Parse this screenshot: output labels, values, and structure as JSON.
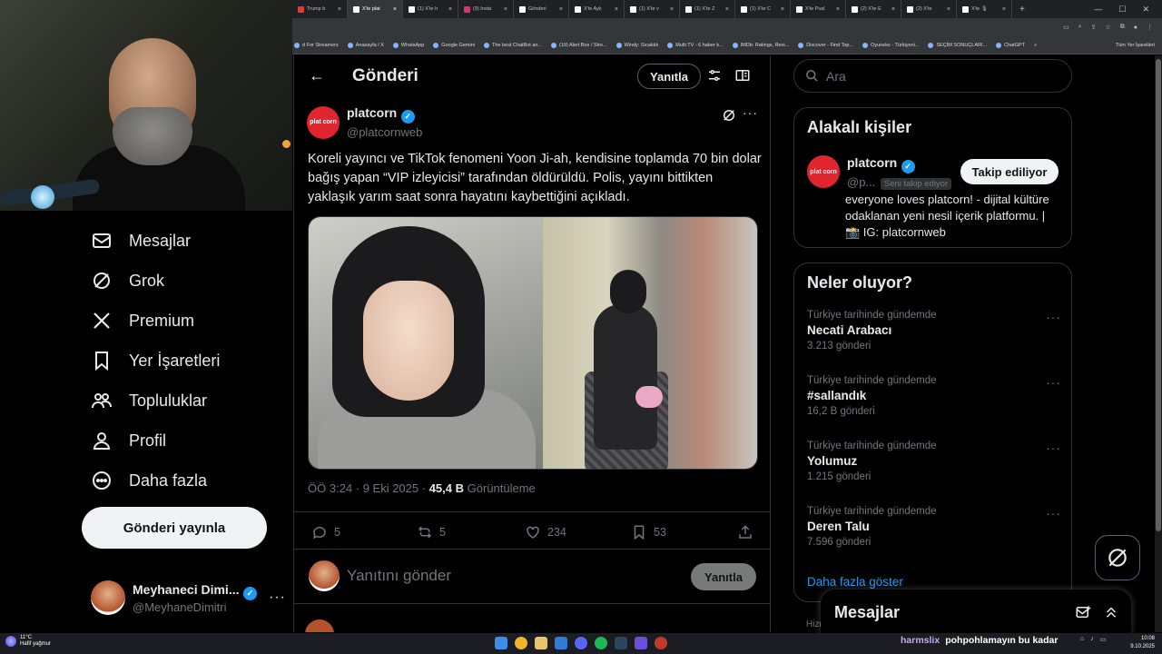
{
  "browser": {
    "tabs": [
      {
        "label": "Trump b",
        "color": "#e53935",
        "active": false
      },
      {
        "label": "X'te plat",
        "color": "#ffffff",
        "active": true
      },
      {
        "label": "(1) X'te h",
        "color": "#ffffff",
        "active": false
      },
      {
        "label": "(9) Insta",
        "color": "#e1306c",
        "active": false
      },
      {
        "label": "Gönderi",
        "color": "#ffffff",
        "active": false
      },
      {
        "label": "X'te Aylı",
        "color": "#ffffff",
        "active": false
      },
      {
        "label": "(1) X'te v",
        "color": "#ffffff",
        "active": false
      },
      {
        "label": "(1) X'te Z",
        "color": "#ffffff",
        "active": false
      },
      {
        "label": "(1) X'te C",
        "color": "#ffffff",
        "active": false
      },
      {
        "label": "X'te Pusl",
        "color": "#ffffff",
        "active": false
      },
      {
        "label": "(2) X'te E",
        "color": "#ffffff",
        "active": false
      },
      {
        "label": "(2) X'te",
        "color": "#ffffff",
        "active": false
      },
      {
        "label": "X'te 🎙",
        "color": "#ffffff",
        "active": false
      }
    ],
    "new_tab": "+",
    "bookmarks": [
      {
        "label": "d For Streamers"
      },
      {
        "label": "Anasayfa / X"
      },
      {
        "label": "WhatsApp"
      },
      {
        "label": "Google Gemini"
      },
      {
        "label": "The best ChatBot an..."
      },
      {
        "label": "(19) Alert Box / Stre..."
      },
      {
        "label": "Windy: Sıcaklık"
      },
      {
        "label": "Multi TV - 6 haber k..."
      },
      {
        "label": "IMDb: Ratings, Revi..."
      },
      {
        "label": "Discover - Find Top..."
      },
      {
        "label": "Oyuneks - Türkiyeni..."
      },
      {
        "label": "SEÇİM SONUÇLARI..."
      },
      {
        "label": "ChatGPT"
      }
    ],
    "bookmarks_overflow": "»",
    "all_bookmarks": "Tüm Yer İşaretleri"
  },
  "sidebar": {
    "items": [
      {
        "label": "Mesajlar",
        "icon": "envelope-icon"
      },
      {
        "label": "Grok",
        "icon": "grok-icon"
      },
      {
        "label": "Premium",
        "icon": "x-logo-icon"
      },
      {
        "label": "Yer İşaretleri",
        "icon": "bookmark-icon"
      },
      {
        "label": "Topluluklar",
        "icon": "communities-icon"
      },
      {
        "label": "Profil",
        "icon": "person-icon"
      },
      {
        "label": "Daha fazla",
        "icon": "more-circle-icon"
      }
    ],
    "post_button": "Gönderi yayınla",
    "account": {
      "name": "Meyhaneci Dimi...",
      "handle": "@MeyhaneDimitri",
      "more": "···"
    }
  },
  "header": {
    "back": "←",
    "title": "Gönderi",
    "reply_pill": "Yanıtla"
  },
  "tweet": {
    "author_name": "platcorn",
    "author_handle": "@platcornweb",
    "logo_text": "plat corn",
    "text": "Koreli yayıncı ve TikTok fenomeni Yoon Ji-ah, kendisine toplamda 70 bin dolar bağış yapan “VIP izleyicisi” tarafından öldürüldü. Polis, yayını bittikten yaklaşık yarım saat sonra hayatını kaybettiğini açıkladı.",
    "time": "ÖÖ 3:24 · 9 Eki 2025 ·",
    "views": "45,4 B",
    "views_label": "Görüntüleme",
    "stats": {
      "replies": "5",
      "reposts": "5",
      "likes": "234",
      "bookmarks": "53"
    },
    "more": "···"
  },
  "reply_box": {
    "placeholder": "Yanıtını gönder",
    "button": "Yanıtla"
  },
  "right": {
    "search_placeholder": "Ara",
    "related": {
      "title": "Alakalı kişiler",
      "name": "platcorn",
      "handle": "@p...",
      "follows_you": "Seni takip ediyor",
      "follow_button": "Takip ediliyor",
      "bio": "everyone loves platcorn! - dijital kültüre odaklanan yeni nesil içerik platformu. | 📸 IG: platcornweb"
    },
    "trends": {
      "title": "Neler oluyor?",
      "items": [
        {
          "context": "Türkiye tarihinde gündemde",
          "name": "Necati Arabacı",
          "count": "3.213 gönderi"
        },
        {
          "context": "Türkiye tarihinde gündemde",
          "name": "#sallandık",
          "count": "16,2 B gönderi"
        },
        {
          "context": "Türkiye tarihinde gündemde",
          "name": "Yolumuz",
          "count": "1.215 gönderi"
        },
        {
          "context": "Türkiye tarihinde gündemde",
          "name": "Deren Talu",
          "count": "7.596 gönderi"
        }
      ],
      "more_dots": "···",
      "show_more": "Daha fazla göster"
    },
    "messages_drawer": "Mesajlar",
    "footer_peek": "Hizm"
  },
  "taskbar": {
    "temp": "11°C",
    "weather": "Hafif yağmur",
    "chat_user": "harmslix",
    "chat_message": "pohpohlamayın bu kadar",
    "time": "10:08",
    "date": "9.10.2025"
  },
  "colors": {
    "accent": "#1d9bf0",
    "border": "#2f3336",
    "muted": "#71767b",
    "logo": "#e0252f"
  }
}
